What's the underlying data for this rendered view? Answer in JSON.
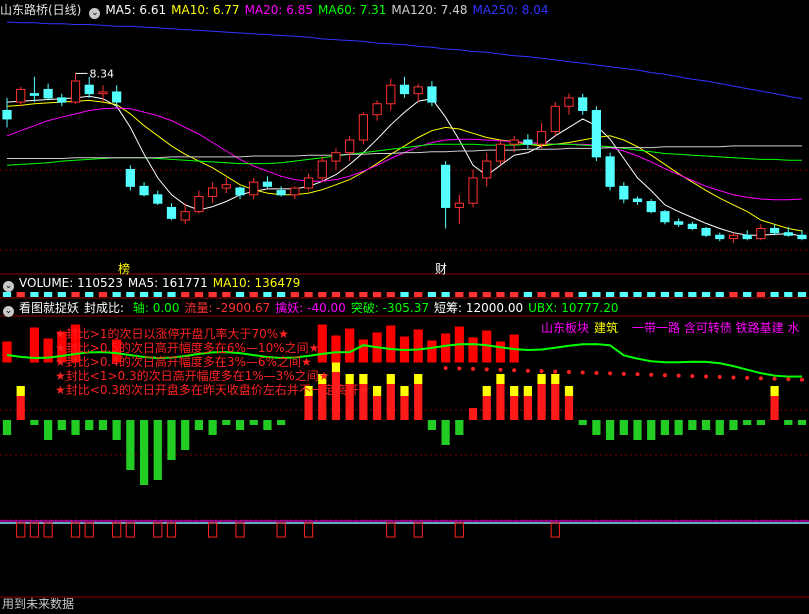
{
  "header": {
    "title": "山东路桥(日线)",
    "ma": [
      {
        "label": "MA5: 6.61",
        "color": "#ffffff"
      },
      {
        "label": "MA10: 6.77",
        "color": "#ffff00"
      },
      {
        "label": "MA20: 6.85",
        "color": "#ff00ff"
      },
      {
        "label": "MA60: 7.31",
        "color": "#00ff00"
      },
      {
        "label": "MA120: 7.48",
        "color": "#cfcfcf"
      },
      {
        "label": "MA250: 8.04",
        "color": "#3333ff"
      }
    ]
  },
  "price_max_label": "8.34",
  "markers": {
    "bang": "榜",
    "cai": "财"
  },
  "volume_bar": {
    "title": "VOLUME: 110523",
    "ma5": "MA5: 161771",
    "ma10": "MA10: 136479"
  },
  "indicator_bar": {
    "title": "看图就捉妖",
    "parts": [
      {
        "label": "封成比: ",
        "color": "#ffffff"
      },
      {
        "label": "轴: 0.00",
        "color": "#00ff00"
      },
      {
        "label": "流量: -2900.67",
        "color": "#ff3333"
      },
      {
        "label": "擒妖: -40.00",
        "color": "#ff00ff"
      },
      {
        "label": "突破: -305.37",
        "color": "#00ff00"
      },
      {
        "label": "短筹: 12000.00",
        "color": "#ffffff"
      },
      {
        "label": "UBX: 10777.20",
        "color": "#00ff00"
      }
    ]
  },
  "sector": {
    "board": "山东板块",
    "board_color": "#ff00ff",
    "industry": "建筑",
    "industry_color": "#ffff00",
    "concepts": "一带一路 含可转债 铁路基建 水",
    "concepts_color": "#ff00ff"
  },
  "notes": [
    "★封比>1的次日以涨停开盘几率大于70%★",
    "★封比>0.5的次日高开幅度多在6%—10%之间★",
    "★封比>0.4的次日高开幅度多在3%—6%之间★",
    "★封比<1>0.3的次日高开幅度多在1%—3%之间★",
    "★封比<0.3的次日开盘多在昨天收盘价左右并不一定高开★"
  ],
  "footer": "用到未来数据",
  "colors": {
    "up": "#ff3232",
    "down": "#54ffff",
    "ma5": "#ffffff",
    "ma10": "#ffff00",
    "ma20": "#ff00ff",
    "ma60": "#00ff00",
    "ma120": "#cfcfcf",
    "ma250": "#3333ff"
  },
  "chart_data": {
    "type": "candlestick",
    "period": "daily",
    "n": 59,
    "candles": [
      [
        7.9,
        8.05,
        7.7,
        7.8
      ],
      [
        8.0,
        8.18,
        7.95,
        8.15
      ],
      [
        8.1,
        8.3,
        8.0,
        8.08
      ],
      [
        8.15,
        8.22,
        8.02,
        8.05
      ],
      [
        8.05,
        8.1,
        7.95,
        8.0
      ],
      [
        8.0,
        8.34,
        7.98,
        8.25
      ],
      [
        8.2,
        8.3,
        8.05,
        8.1
      ],
      [
        8.1,
        8.2,
        8.0,
        8.12
      ],
      [
        8.12,
        8.2,
        7.95,
        8.0
      ],
      [
        7.2,
        7.25,
        6.95,
        7.0
      ],
      [
        7.0,
        7.05,
        6.88,
        6.9
      ],
      [
        6.9,
        6.95,
        6.78,
        6.8
      ],
      [
        6.75,
        6.8,
        6.6,
        6.62
      ],
      [
        6.6,
        6.8,
        6.55,
        6.7
      ],
      [
        6.7,
        6.95,
        6.68,
        6.88
      ],
      [
        6.88,
        7.05,
        6.8,
        6.98
      ],
      [
        6.98,
        7.1,
        6.92,
        7.02
      ],
      [
        6.98,
        7.0,
        6.85,
        6.9
      ],
      [
        6.9,
        7.1,
        6.85,
        7.05
      ],
      [
        7.05,
        7.12,
        6.98,
        7.0
      ],
      [
        6.95,
        7.0,
        6.88,
        6.9
      ],
      [
        6.9,
        7.0,
        6.85,
        6.98
      ],
      [
        6.98,
        7.15,
        6.95,
        7.1
      ],
      [
        7.1,
        7.35,
        7.05,
        7.3
      ],
      [
        7.3,
        7.45,
        7.2,
        7.4
      ],
      [
        7.4,
        7.6,
        7.3,
        7.55
      ],
      [
        7.55,
        7.88,
        7.5,
        7.85
      ],
      [
        7.85,
        8.02,
        7.78,
        7.98
      ],
      [
        7.98,
        8.28,
        7.9,
        8.2
      ],
      [
        8.2,
        8.3,
        8.05,
        8.1
      ],
      [
        8.1,
        8.22,
        8.0,
        8.18
      ],
      [
        8.18,
        8.25,
        7.95,
        8.0
      ],
      [
        7.25,
        7.3,
        6.5,
        6.75
      ],
      [
        6.75,
        6.9,
        6.55,
        6.8
      ],
      [
        6.8,
        7.2,
        6.75,
        7.1
      ],
      [
        7.1,
        7.4,
        7.0,
        7.3
      ],
      [
        7.3,
        7.55,
        7.25,
        7.5
      ],
      [
        7.5,
        7.6,
        7.4,
        7.55
      ],
      [
        7.55,
        7.62,
        7.45,
        7.5
      ],
      [
        7.5,
        7.75,
        7.45,
        7.65
      ],
      [
        7.65,
        8.0,
        7.6,
        7.95
      ],
      [
        7.95,
        8.1,
        7.85,
        8.05
      ],
      [
        8.05,
        8.1,
        7.85,
        7.9
      ],
      [
        7.9,
        7.95,
        7.3,
        7.35
      ],
      [
        7.35,
        7.4,
        6.95,
        7.0
      ],
      [
        7.0,
        7.05,
        6.8,
        6.85
      ],
      [
        6.85,
        6.88,
        6.78,
        6.82
      ],
      [
        6.82,
        6.85,
        6.68,
        6.7
      ],
      [
        6.7,
        6.72,
        6.55,
        6.58
      ],
      [
        6.58,
        6.62,
        6.52,
        6.55
      ],
      [
        6.55,
        6.58,
        6.48,
        6.5
      ],
      [
        6.5,
        6.52,
        6.4,
        6.42
      ],
      [
        6.42,
        6.45,
        6.35,
        6.38
      ],
      [
        6.38,
        6.45,
        6.33,
        6.42
      ],
      [
        6.42,
        6.48,
        6.36,
        6.38
      ],
      [
        6.38,
        6.55,
        6.36,
        6.5
      ],
      [
        6.5,
        6.55,
        6.42,
        6.45
      ],
      [
        6.45,
        6.52,
        6.4,
        6.42
      ],
      [
        6.42,
        6.48,
        6.36,
        6.38
      ]
    ],
    "ma_keys": {
      "ma5": [
        8.0,
        8.01,
        8.02,
        8.03,
        8.04,
        8.05,
        8.07,
        8.04,
        7.95,
        7.7,
        7.38,
        7.1,
        6.9,
        6.78,
        6.72,
        6.76,
        6.82,
        6.9,
        6.94,
        6.97,
        6.97,
        6.97,
        7.0,
        7.06,
        7.14,
        7.26,
        7.4,
        7.56,
        7.73,
        7.88,
        8.01,
        8.04,
        7.82,
        7.55,
        7.25,
        7.13,
        7.25,
        7.37,
        7.4,
        7.48,
        7.6,
        7.7,
        7.8,
        7.72,
        7.56,
        7.33,
        7.1,
        6.95,
        6.78,
        6.7,
        6.63,
        6.56,
        6.5,
        6.45,
        6.42,
        6.42,
        6.43,
        6.44,
        6.41
      ],
      "ma10": [
        7.95,
        7.96,
        7.98,
        7.99,
        8.0,
        8.01,
        8.02,
        8.0,
        7.97,
        7.86,
        7.72,
        7.6,
        7.48,
        7.38,
        7.3,
        7.22,
        7.12,
        7.02,
        6.96,
        6.92,
        6.9,
        6.9,
        6.92,
        6.96,
        7.02,
        7.08,
        7.17,
        7.27,
        7.38,
        7.48,
        7.58,
        7.66,
        7.7,
        7.68,
        7.63,
        7.58,
        7.55,
        7.53,
        7.5,
        7.48,
        7.5,
        7.52,
        7.55,
        7.58,
        7.6,
        7.55,
        7.47,
        7.37,
        7.26,
        7.15,
        7.05,
        6.95,
        6.86,
        6.78,
        6.7,
        6.6,
        6.55,
        6.5,
        6.47
      ],
      "ma20": [
        7.6,
        7.66,
        7.72,
        7.78,
        7.82,
        7.86,
        7.9,
        7.92,
        7.93,
        7.92,
        7.88,
        7.84,
        7.78,
        7.7,
        7.62,
        7.52,
        7.42,
        7.32,
        7.24,
        7.18,
        7.12,
        7.08,
        7.06,
        7.06,
        7.08,
        7.12,
        7.18,
        7.25,
        7.33,
        7.4,
        7.47,
        7.52,
        7.55,
        7.56,
        7.56,
        7.55,
        7.54,
        7.53,
        7.52,
        7.51,
        7.5,
        7.5,
        7.5,
        7.49,
        7.46,
        7.42,
        7.36,
        7.29,
        7.21,
        7.14,
        7.07,
        7.0,
        6.95,
        6.9,
        6.87,
        6.85,
        6.84,
        6.84,
        6.85
      ],
      "ma60": [
        7.25,
        7.26,
        7.27,
        7.28,
        7.3,
        7.31,
        7.32,
        7.33,
        7.34,
        7.34,
        7.34,
        7.33,
        7.32,
        7.31,
        7.3,
        7.29,
        7.28,
        7.27,
        7.27,
        7.27,
        7.28,
        7.3,
        7.32,
        7.34,
        7.36,
        7.38,
        7.4,
        7.42,
        7.44,
        7.46,
        7.48,
        7.5,
        7.5,
        7.5,
        7.5,
        7.49,
        7.49,
        7.49,
        7.5,
        7.5,
        7.5,
        7.5,
        7.49,
        7.48,
        7.47,
        7.45,
        7.43,
        7.41,
        7.39,
        7.38,
        7.37,
        7.36,
        7.35,
        7.34,
        7.33,
        7.32,
        7.32,
        7.31,
        7.31
      ],
      "ma120": [
        7.33,
        7.33,
        7.33,
        7.33,
        7.33,
        7.34,
        7.34,
        7.34,
        7.34,
        7.34,
        7.34,
        7.34,
        7.35,
        7.35,
        7.35,
        7.35,
        7.35,
        7.35,
        7.36,
        7.36,
        7.36,
        7.36,
        7.37,
        7.37,
        7.37,
        7.38,
        7.38,
        7.39,
        7.39,
        7.4,
        7.4,
        7.41,
        7.41,
        7.42,
        7.42,
        7.43,
        7.43,
        7.43,
        7.44,
        7.44,
        7.44,
        7.45,
        7.45,
        7.45,
        7.46,
        7.46,
        7.46,
        7.46,
        7.47,
        7.47,
        7.47,
        7.47,
        7.47,
        7.48,
        7.48,
        7.48,
        7.48,
        7.48,
        7.48
      ],
      "ma250": [
        8.95,
        8.94,
        8.94,
        8.93,
        8.93,
        8.92,
        8.92,
        8.91,
        8.9,
        8.9,
        8.89,
        8.88,
        8.87,
        8.86,
        8.85,
        8.84,
        8.83,
        8.82,
        8.81,
        8.8,
        8.79,
        8.78,
        8.77,
        8.75,
        8.74,
        8.73,
        8.72,
        8.7,
        8.69,
        8.68,
        8.66,
        8.65,
        8.63,
        8.62,
        8.6,
        8.59,
        8.57,
        8.55,
        8.54,
        8.52,
        8.5,
        8.48,
        8.46,
        8.44,
        8.42,
        8.4,
        8.38,
        8.35,
        8.33,
        8.3,
        8.27,
        8.25,
        8.22,
        8.19,
        8.16,
        8.13,
        8.1,
        8.07,
        8.04
      ]
    },
    "price_ylim": [
      6.15,
      8.95
    ],
    "volume_ylim": [
      0,
      300000
    ],
    "indicator_ylim": [
      -12000,
      12000
    ]
  }
}
